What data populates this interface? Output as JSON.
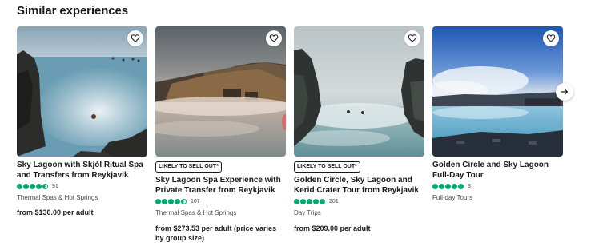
{
  "section_title": "Similar experiences",
  "cards": [
    {
      "title": "Sky Lagoon with Skjól Ritual Spa and Transfers from Reykjavik",
      "badge": "",
      "rating": 4.5,
      "review_count": "91",
      "category": "Thermal Spas & Hot Springs",
      "price": "from $130.00 per adult",
      "photo": "sky-lagoon-bathers-steam"
    },
    {
      "title": "Sky Lagoon Spa Experience with Private Transfer from Reykjavik",
      "badge": "LIKELY TO SELL OUT*",
      "rating": 4.5,
      "review_count": "107",
      "category": "Thermal Spas & Hot Springs",
      "price": "from $273.53 per adult (price varies by group size)",
      "photo": "turf-house-lagoon"
    },
    {
      "title": "Golden Circle, Sky Lagoon and Kerid Crater Tour from Reykjavik",
      "badge": "LIKELY TO SELL OUT*",
      "rating": 5,
      "review_count": "201",
      "category": "Day Trips",
      "price": "from $209.00 per adult",
      "photo": "lagoon-rock-cliffs"
    },
    {
      "title": "Golden Circle and Sky Lagoon Full-Day Tour",
      "badge": "",
      "rating": 5,
      "review_count": "3",
      "category": "Full-day Tours",
      "price": "",
      "photo": "blue-lagoon-dusk"
    }
  ],
  "colors": {
    "rating_green": "#00aa6c",
    "text": "#1a1a1a",
    "muted": "#4a4a4a"
  },
  "icons": {
    "favorite": "heart-icon",
    "next": "arrow-right-icon"
  }
}
